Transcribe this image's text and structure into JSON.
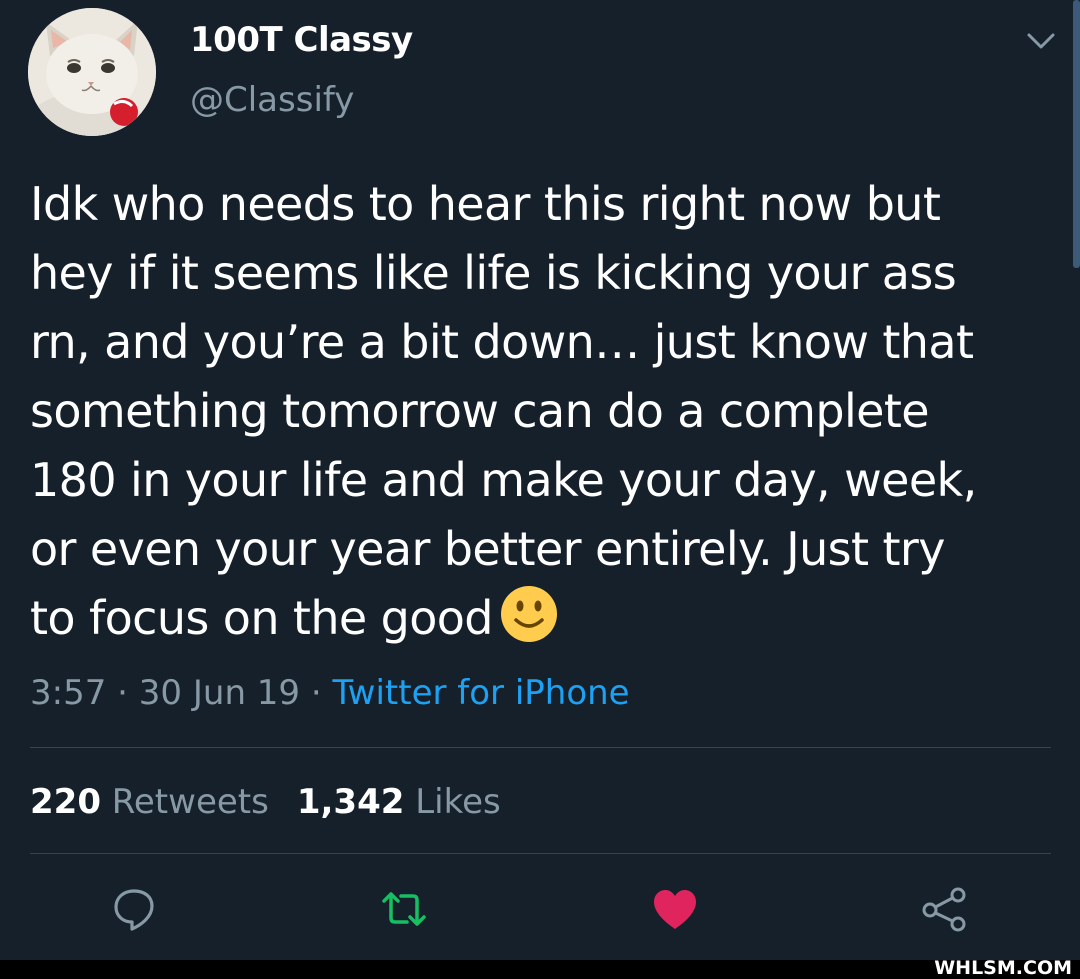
{
  "author": {
    "display_name": "100T Classy",
    "handle": "@Classify"
  },
  "tweet": {
    "lines": [
      "Idk who needs to hear this right now but",
      "hey if it seems like life is kicking your ass",
      "rn, and you’re a bit down… just know that",
      "something tomorrow can do a complete",
      "180 in your life and make your day, week,",
      "or even your year better entirely. Just try",
      "to focus on the good"
    ],
    "emoji": "slightly-smiling-face-emoji"
  },
  "meta": {
    "time": "3:57",
    "sep1": " · ",
    "date": "30 Jun 19",
    "sep2": " · ",
    "source": "Twitter for iPhone"
  },
  "stats": {
    "retweets_count": "220",
    "retweets_label": "Retweets",
    "likes_count": "1,342",
    "likes_label": "Likes"
  },
  "actions": {
    "reply_icon": "reply-icon",
    "retweet_icon": "retweet-icon",
    "like_icon": "heart-icon",
    "share_icon": "share-icon"
  },
  "colors": {
    "background": "#15202b",
    "secondary_text": "#8899a6",
    "link": "#1da1f2",
    "retweet_active": "#17bf63",
    "like_active": "#e0245e"
  },
  "watermark": "WHLSM.COM"
}
